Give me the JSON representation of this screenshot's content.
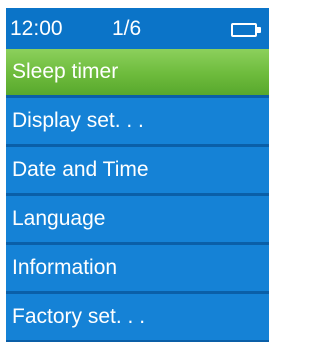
{
  "status_bar": {
    "time": "12:00",
    "page_indicator": "1/6",
    "battery_icon": "battery-full-icon"
  },
  "menu": {
    "selected_index": 0,
    "items": [
      {
        "label": "Sleep timer"
      },
      {
        "label": "Display set. . ."
      },
      {
        "label": "Date and Time"
      },
      {
        "label": "Language"
      },
      {
        "label": "Information"
      },
      {
        "label": "Factory set. . ."
      }
    ]
  },
  "colors": {
    "background": "#0b74c8",
    "item_background": "#1582d6",
    "selected_background": "#6dbb3c",
    "text": "#ffffff"
  }
}
